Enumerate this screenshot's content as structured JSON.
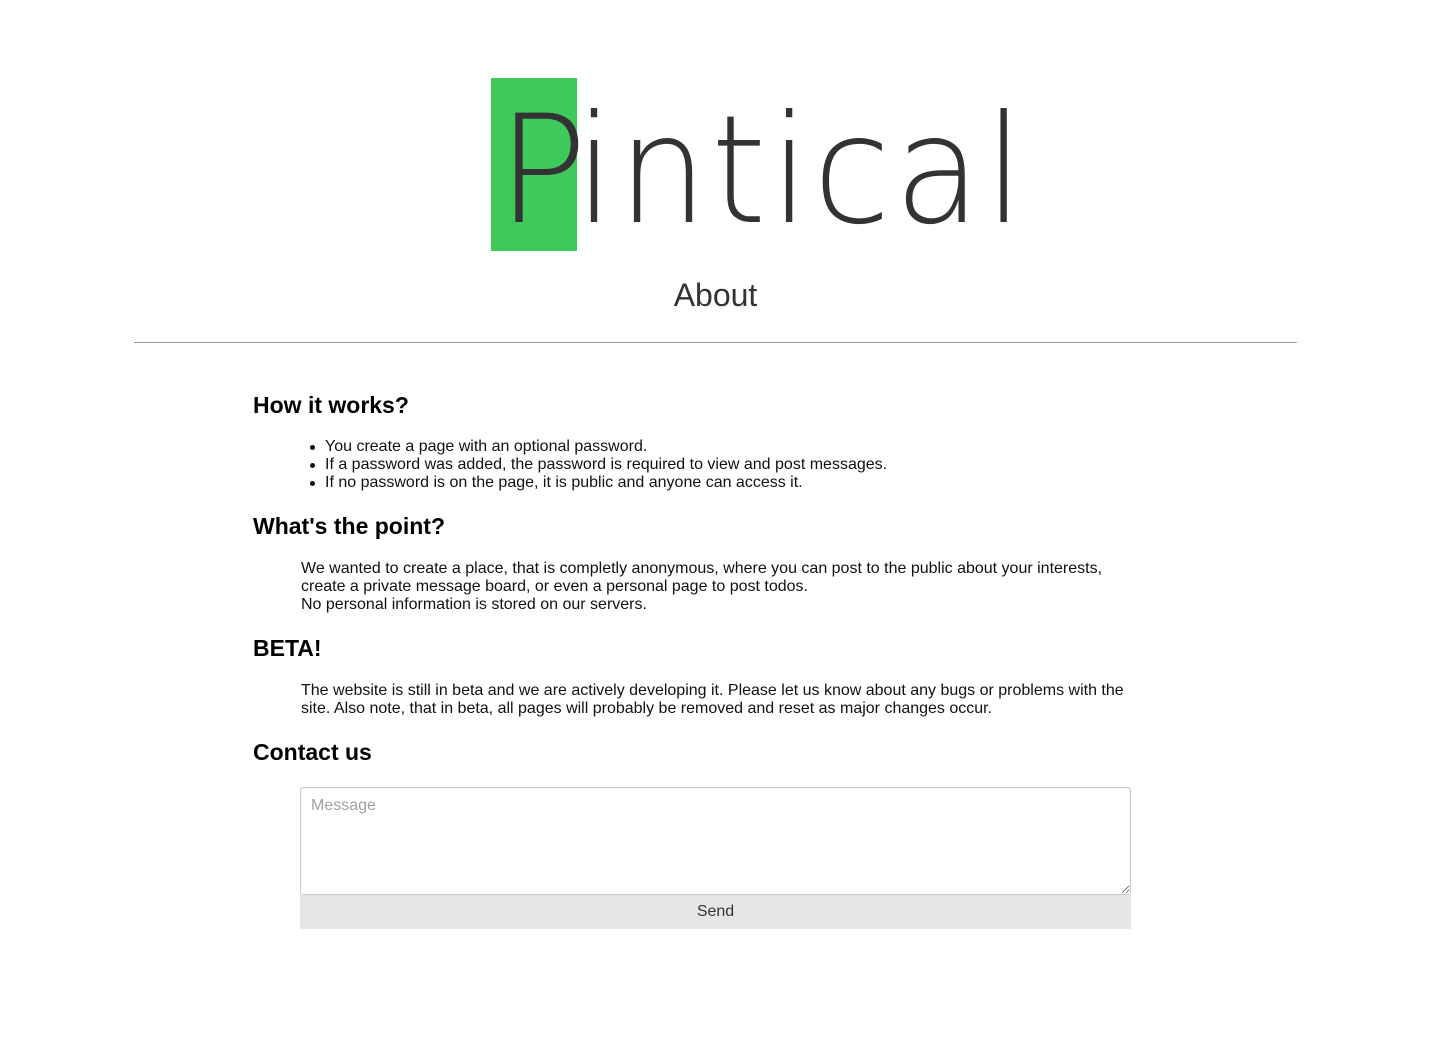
{
  "logo": {
    "first_letter": "P",
    "rest": "intical",
    "accent_color": "#3ec95a"
  },
  "page": {
    "title": "About"
  },
  "how_it_works": {
    "heading": "How it works?",
    "items": [
      "You create a page with an optional password.",
      "If a password was added, the password is required to view and post messages.",
      "If no password is on the page, it is public and anyone can access it."
    ]
  },
  "whats_the_point": {
    "heading": "What's the point?",
    "lines": [
      "We wanted to create a place, that is completly anonymous, where you can post to the public about your interests,",
      "create a private message board, or even a personal page to post todos.",
      "No personal information is stored on our servers."
    ]
  },
  "beta": {
    "heading": "BETA!",
    "lines": [
      "The website is still in beta and we are actively developing it. Please let us know about any bugs or problems with the",
      "site. Also note, that in beta, all pages will probably be removed and reset as major changes occur."
    ]
  },
  "contact": {
    "heading": "Contact us",
    "message_placeholder": "Message",
    "message_value": "",
    "send_label": "Send"
  }
}
